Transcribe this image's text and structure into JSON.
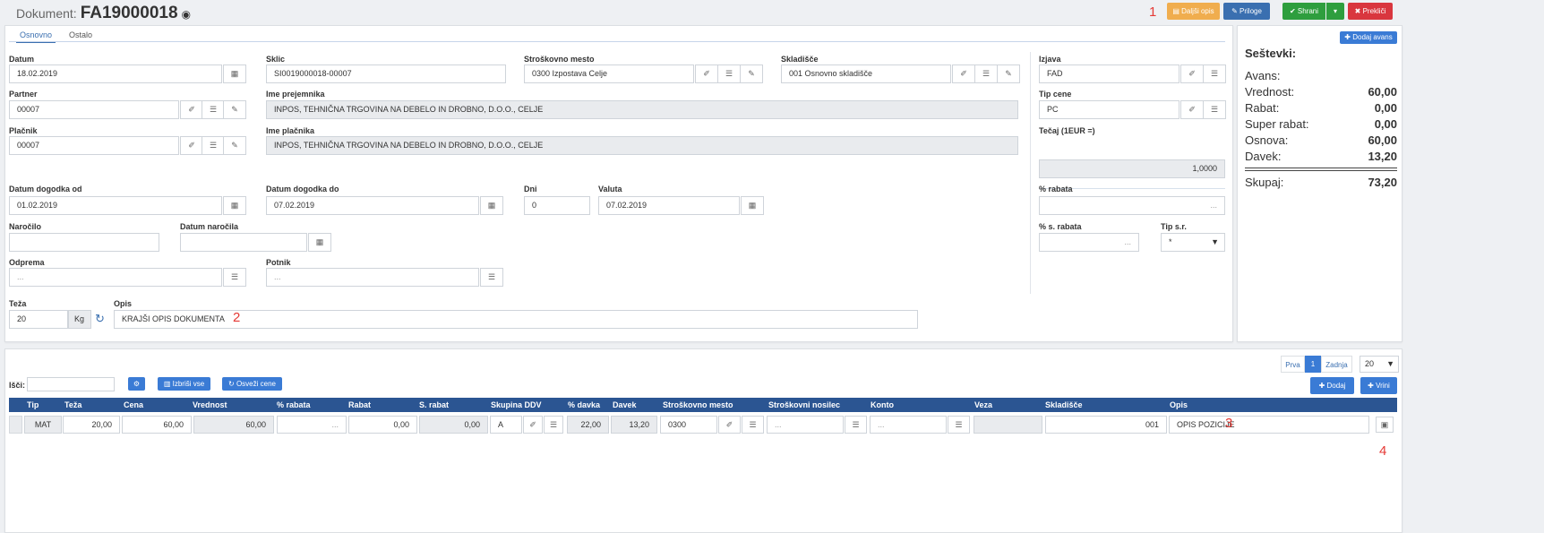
{
  "header": {
    "doc_label": "Dokument:",
    "doc_number": "FA19000018",
    "btn_dalsi": "Daljši opis",
    "btn_priloge": "Priloge",
    "btn_shrani": "Shrani",
    "btn_prekini": "Prekliči"
  },
  "tabs": [
    "Osnovno",
    "Ostalo"
  ],
  "form": {
    "datum_label": "Datum",
    "datum": "18.02.2019",
    "sklic_label": "Sklic",
    "sklic": "SI0019000018-00007",
    "strosek_label": "Stroškovno mesto",
    "strosek": "0300 Izpostava Celje",
    "skladisce_label": "Skladišče",
    "skladisce": "001 Osnovno skladišče",
    "izjava_label": "Izjava",
    "izjava": "FAD",
    "partner_label": "Partner",
    "partner": "00007",
    "ime_prej_label": "Ime prejemnika",
    "ime_prej": "INPOS, TEHNIČNA TRGOVINA NA DEBELO IN DROBNO, D.O.O., CELJE",
    "tip_cene_label": "Tip cene",
    "tip_cene": "PC",
    "placnik_label": "Plačnik",
    "placnik": "00007",
    "ime_plac_label": "Ime plačnika",
    "ime_plac": "INPOS, TEHNIČNA TRGOVINA NA DEBELO IN DROBNO, D.O.O., CELJE",
    "tecaj_label": "Tečaj (1EUR =)",
    "tecaj": "1,0000",
    "dd_od_label": "Datum dogodka od",
    "dd_od": "01.02.2019",
    "dd_do_label": "Datum dogodka do",
    "dd_do": "07.02.2019",
    "dni_label": "Dni",
    "dni": "0",
    "valuta_label": "Valuta",
    "valuta": "07.02.2019",
    "rabat_label": "% rabata",
    "rabat_ph": "...",
    "narocilo_label": "Naročilo",
    "dat_nar_label": "Datum naročila",
    "srabat_label": "% s. rabata",
    "srabat_ph": "...",
    "tipsr_label": "Tip s.r.",
    "tipsr": "*",
    "odprema_label": "Odprema",
    "odprema_ph": "...",
    "potnik_label": "Potnik",
    "potnik_ph": "...",
    "teza_label": "Teža",
    "teza": "20",
    "teza_unit": "Kg",
    "opis_label": "Opis",
    "opis": "KRAJŠI OPIS DOKUMENTA"
  },
  "summary": {
    "title": "Seštevki:",
    "add_btn": "Dodaj avans",
    "rows": [
      {
        "k": "Avans:",
        "v": ""
      },
      {
        "k": "Vrednost:",
        "v": "60,00"
      },
      {
        "k": "Rabat:",
        "v": "0,00"
      },
      {
        "k": "Super rabat:",
        "v": "0,00"
      },
      {
        "k": "Osnova:",
        "v": "60,00"
      },
      {
        "k": "Davek:",
        "v": "13,20"
      }
    ],
    "total_k": "Skupaj:",
    "total_v": "73,20"
  },
  "pager": {
    "prva": "Prva",
    "page": "1",
    "zadnja": "Zadnja",
    "size": "20"
  },
  "table": {
    "search_label": "Išči:",
    "btn_izbrisi": "Izbriši vse",
    "btn_osvezi": "Osveži cene",
    "btn_dodaj": "Dodaj",
    "btn_vrini": "Vrini",
    "headers": [
      "Tip",
      "Teža",
      "Cena",
      "Vrednost",
      "% rabata",
      "Rabat",
      "S. rabat",
      "Skupina DDV",
      "% davka",
      "Davek",
      "Stroškovno mesto",
      "Stroškovni nosilec",
      "Konto",
      "Veza",
      "Skladišče",
      "Opis"
    ],
    "row": {
      "tip": "MAT",
      "teza": "20,00",
      "cena": "60,00",
      "vrednost": "60,00",
      "rabata_ph": "...",
      "rabat": "0,00",
      "srabat": "0,00",
      "skupina": "A",
      "davka": "22,00",
      "davek": "13,20",
      "strosek": "0300",
      "nosilec_ph": "...",
      "konto_ph": "...",
      "skladisce": "001",
      "opis": "OPIS POZICIJE"
    }
  },
  "annotations": [
    "1",
    "2",
    "3",
    "4"
  ]
}
